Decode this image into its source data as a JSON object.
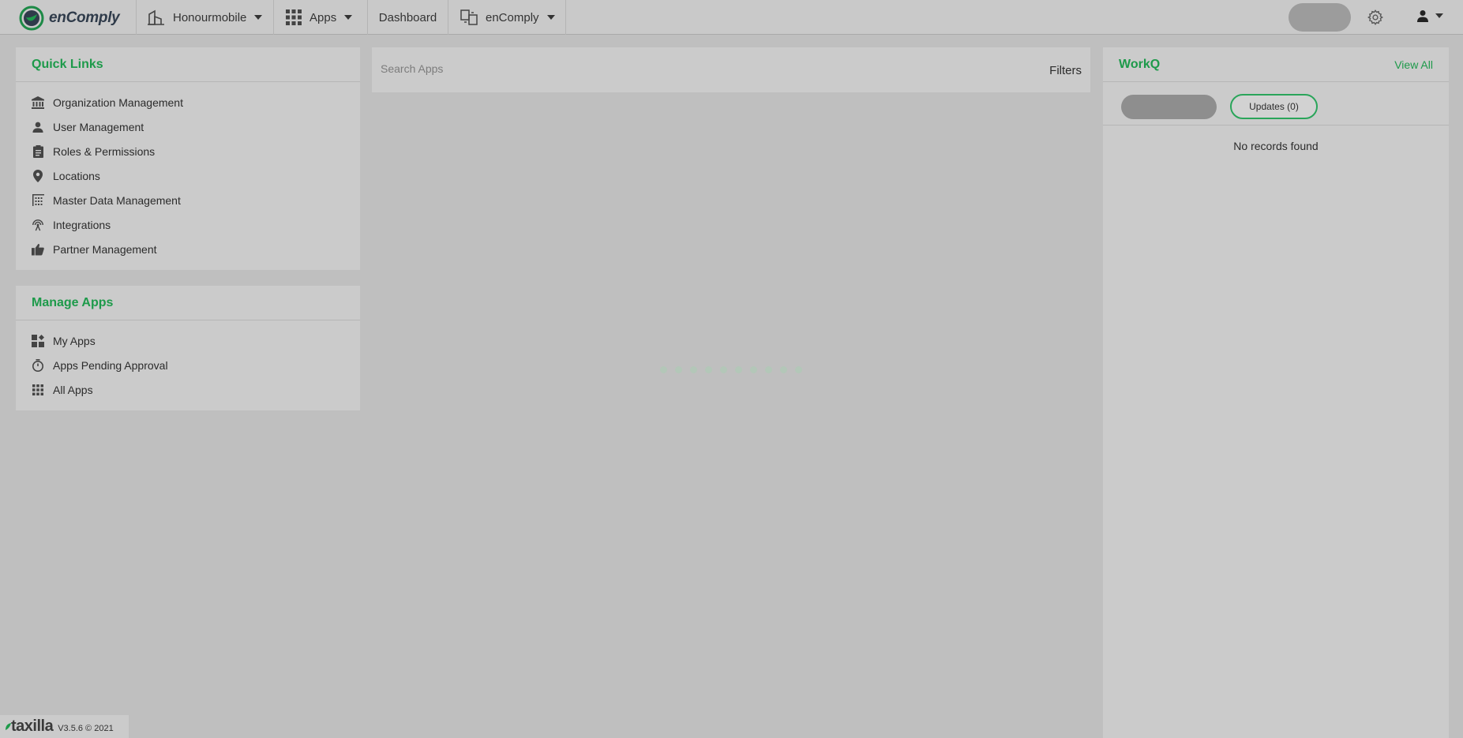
{
  "brand": {
    "name": "enComply",
    "accent": "#1d9a4a"
  },
  "topnav": {
    "org_label": "Honourmobile",
    "apps_label": "Apps",
    "dashboard_label": "Dashboard",
    "product_label": "enComply"
  },
  "quick_links": {
    "title": "Quick Links",
    "items": [
      {
        "label": "Organization Management",
        "icon": "bank-icon"
      },
      {
        "label": "User Management",
        "icon": "user-icon"
      },
      {
        "label": "Roles & Permissions",
        "icon": "clipboard-icon"
      },
      {
        "label": "Locations",
        "icon": "map-pin-icon"
      },
      {
        "label": "Master Data Management",
        "icon": "data-grid-icon"
      },
      {
        "label": "Integrations",
        "icon": "antenna-icon"
      },
      {
        "label": "Partner Management",
        "icon": "thumbs-up-icon"
      }
    ]
  },
  "manage_apps": {
    "title": "Manage Apps",
    "items": [
      {
        "label": "My Apps",
        "icon": "widgets-icon"
      },
      {
        "label": "Apps Pending Approval",
        "icon": "timer-icon"
      },
      {
        "label": "All Apps",
        "icon": "grid-icon"
      }
    ]
  },
  "search": {
    "placeholder": "Search Apps",
    "filters_label": "Filters"
  },
  "workq": {
    "title": "WorkQ",
    "view_all": "View All",
    "updates_tab": "Updates (0)",
    "empty_text": "No records found"
  },
  "footer": {
    "logo_text": "taxilla",
    "version": "V3.5.6 © 2021"
  }
}
